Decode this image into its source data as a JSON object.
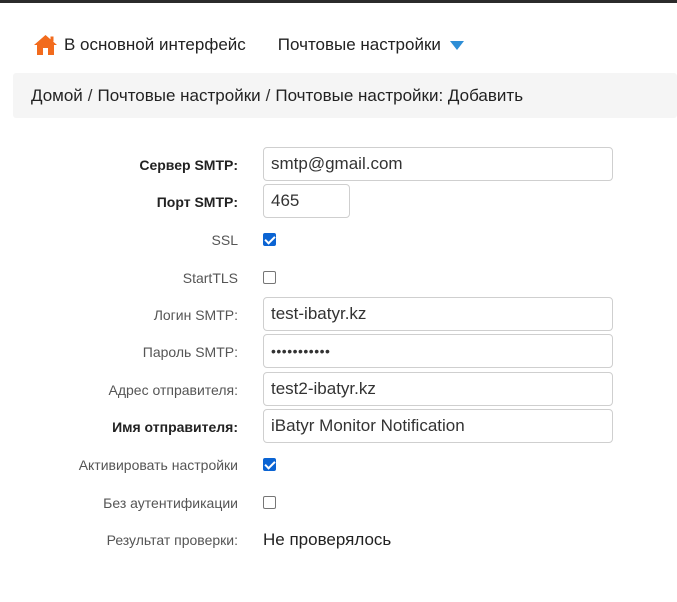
{
  "nav": {
    "home_label": "В основной интерфейс",
    "menu_label": "Почтовые настройки"
  },
  "breadcrumb": {
    "items": [
      "Домой",
      "Почтовые настройки",
      "Почтовые настройки: Добавить"
    ],
    "separator": "/"
  },
  "form": {
    "smtp_server": {
      "label": "Сервер SMTP:",
      "value": "smtp@gmail.com"
    },
    "smtp_port": {
      "label": "Порт SMTP:",
      "value": "465"
    },
    "ssl": {
      "label": "SSL",
      "checked": true
    },
    "starttls": {
      "label": "StartTLS",
      "checked": false
    },
    "smtp_login": {
      "label": "Логин SMTP:",
      "value": "test-ibatyr.kz"
    },
    "smtp_password": {
      "label": "Пароль SMTP:",
      "value": "•••••••••••"
    },
    "sender_address": {
      "label": "Адрес отправителя:",
      "value": "test2-ibatyr.kz"
    },
    "sender_name": {
      "label": "Имя отправителя:",
      "value": "iBatyr Monitor Notification"
    },
    "activate": {
      "label": "Активировать настройки",
      "checked": true
    },
    "no_auth": {
      "label": "Без аутентификации",
      "checked": false
    },
    "check_result": {
      "label": "Результат проверки:",
      "value": "Не проверялось"
    }
  },
  "colors": {
    "accent": "#2e8ed6",
    "checkbox": "#0b64d3",
    "home_icon": "#f26b1d"
  }
}
